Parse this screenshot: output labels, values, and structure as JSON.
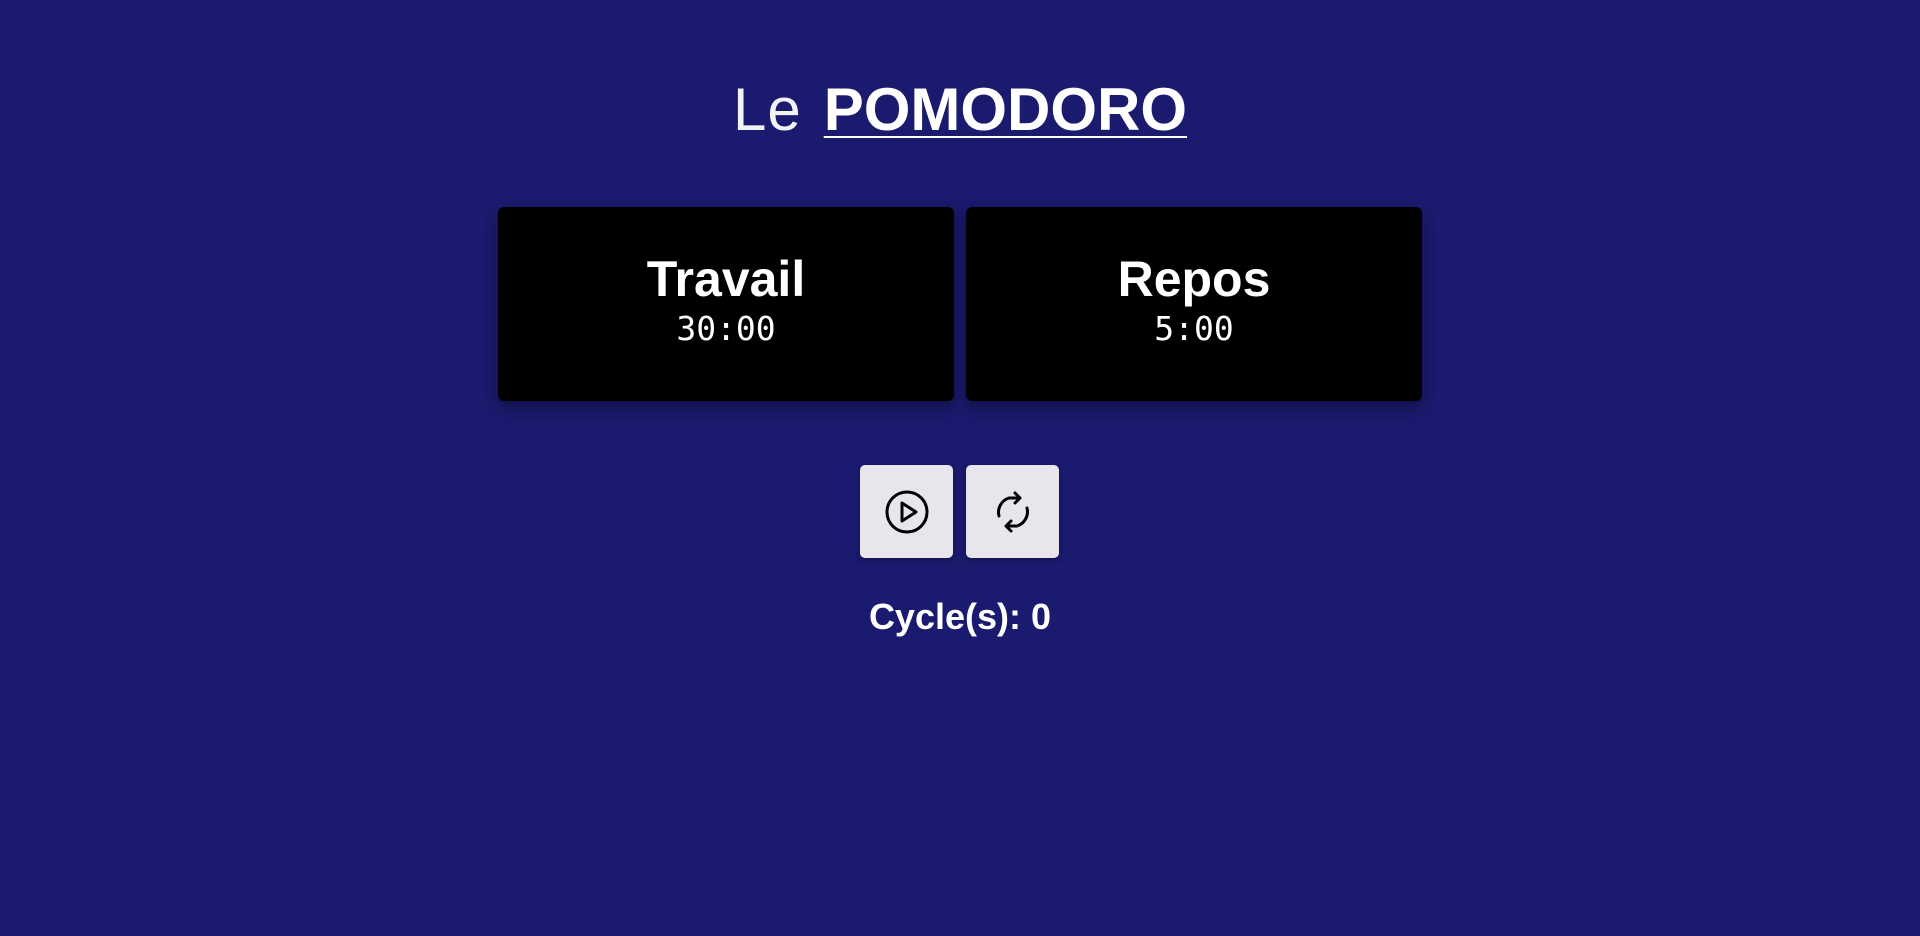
{
  "header": {
    "title_prefix": "Le",
    "title_main": "POMODORO"
  },
  "timers": [
    {
      "label": "Travail",
      "time": "30:00"
    },
    {
      "label": "Repos",
      "time": "5:00"
    }
  ],
  "controls": {
    "play_icon": "play-circle-icon",
    "reset_icon": "refresh-icon"
  },
  "cycles": {
    "label": "Cycle(s):",
    "count": "0"
  },
  "colors": {
    "background": "#1a1a6e",
    "card": "#000000",
    "button": "#e8e6ec",
    "text": "#ffffff"
  }
}
